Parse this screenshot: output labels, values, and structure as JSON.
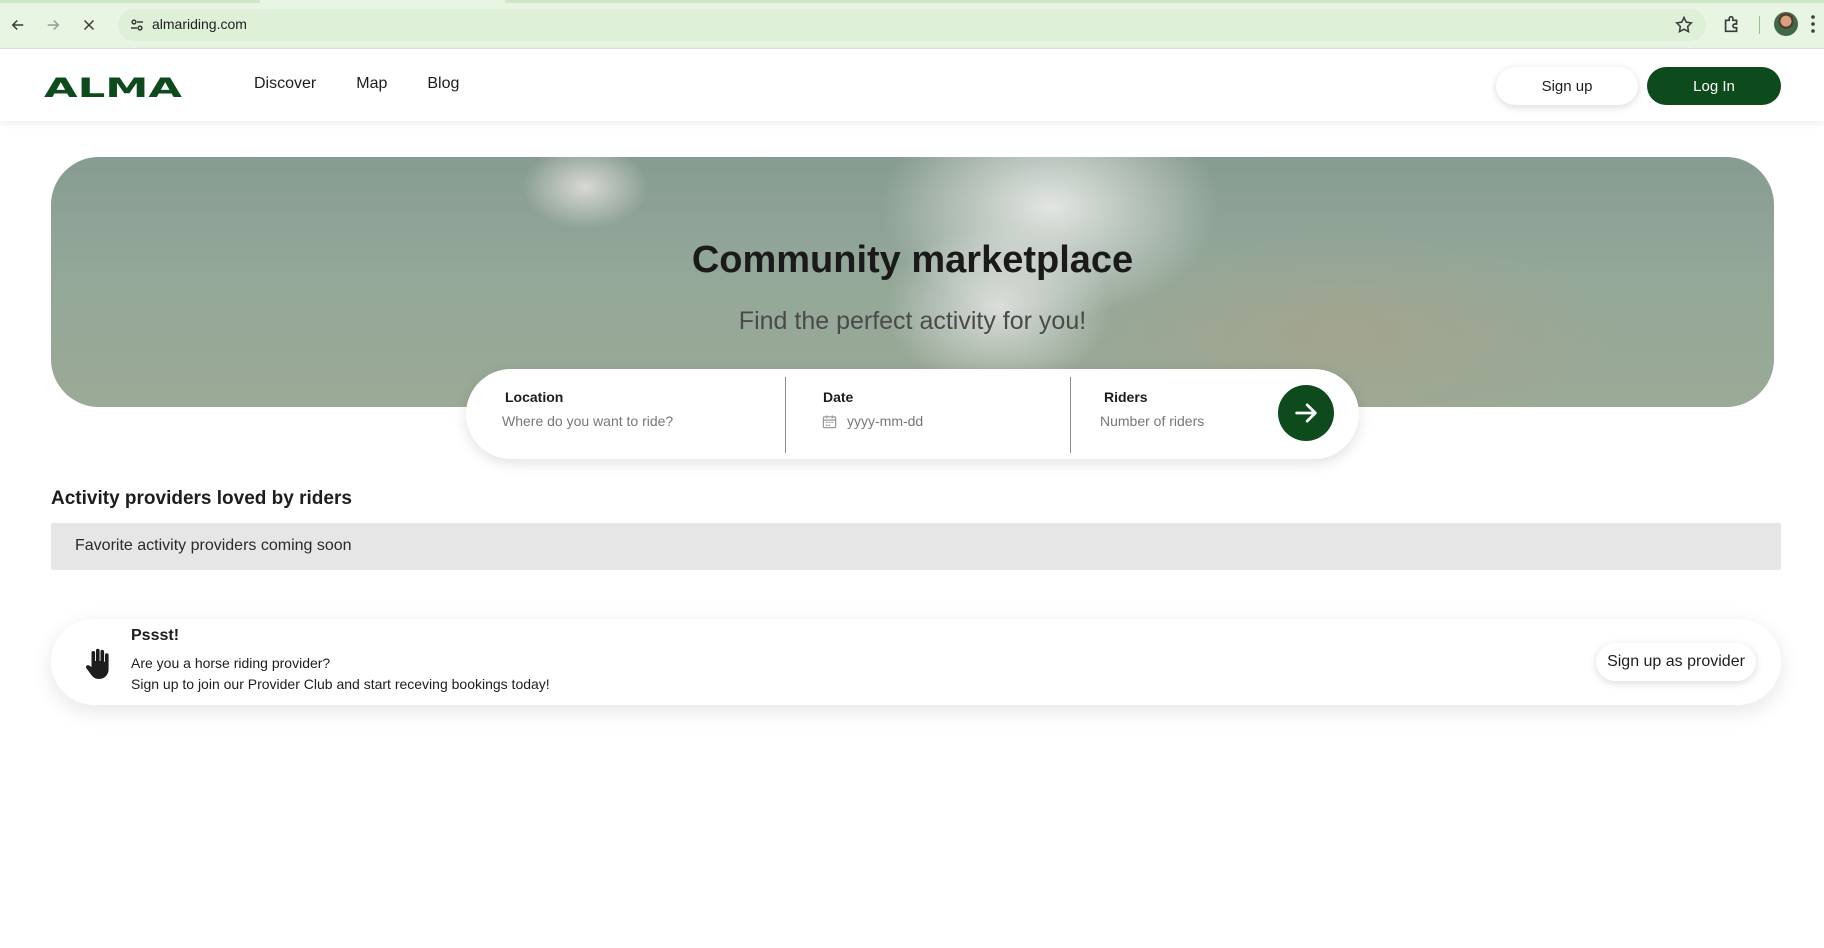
{
  "browser": {
    "url": "almariding.com"
  },
  "header": {
    "logo_text": "ALMA",
    "nav": [
      "Discover",
      "Map",
      "Blog"
    ],
    "signup_label": "Sign up",
    "login_label": "Log In",
    "brand_color": "#0d4a1c"
  },
  "hero": {
    "title": "Community marketplace",
    "subtitle": "Find the perfect activity for you!"
  },
  "search": {
    "location_label": "Location",
    "location_placeholder": "Where do you want to ride?",
    "date_label": "Date",
    "date_placeholder": "yyyy-mm-dd",
    "riders_label": "Riders",
    "riders_placeholder": "Number of riders",
    "submit_icon": "arrow-right-icon"
  },
  "providers": {
    "title": "Activity providers loved by riders",
    "empty_text": "Favorite activity providers coming soon"
  },
  "promo": {
    "icon": "hand-icon",
    "title": "Pssst!",
    "line1": "Are you a horse riding provider?",
    "line2": "Sign up to join our Provider Club and start receving bookings today!",
    "cta_label": "Sign up as provider"
  }
}
